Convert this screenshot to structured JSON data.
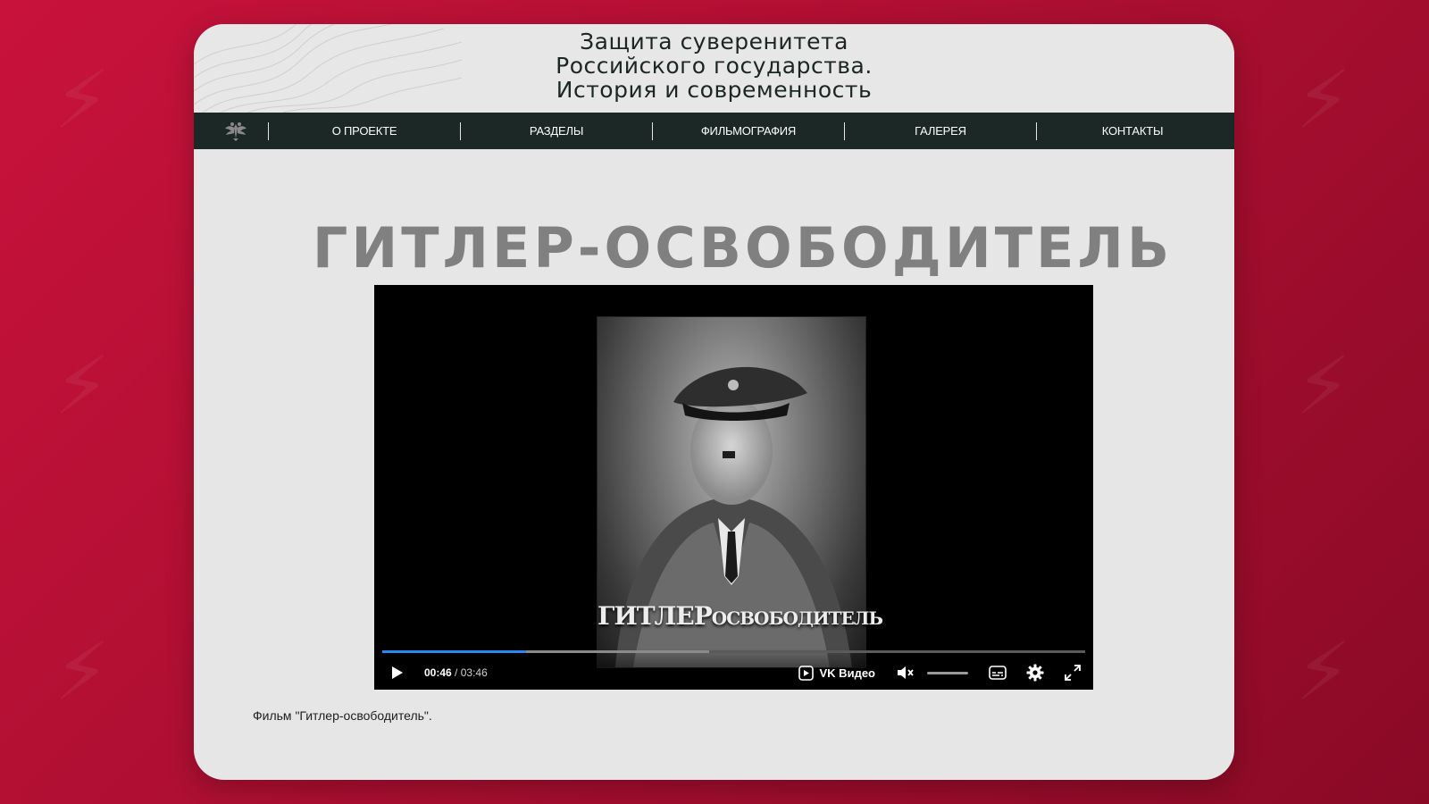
{
  "site": {
    "title_lines": [
      "Защита суверенитета",
      "Российского государства.",
      "История и современность"
    ]
  },
  "nav": {
    "logo_icon": "double-headed-eagle-icon",
    "items": [
      "О ПРОЕКТЕ",
      "РАЗДЕЛЫ",
      "ФИЛЬМОГРАФИЯ",
      "ГАЛЕРЕЯ",
      "КОНТАКТЫ"
    ]
  },
  "page": {
    "heading": "ГИТЛЕР-ОСВОБОДИТЕЛЬ",
    "caption": "Фильм \"Гитлер-освободитель\"."
  },
  "player": {
    "poster_text_large": "ГИТЛЕР",
    "poster_text_small": "ОСВОБОДИТЕЛЬ",
    "current_time": "00:46",
    "time_separator": " / ",
    "duration": "03:46",
    "played_fraction": 0.205,
    "buffered_fraction": 0.465,
    "brand_label": "VK Видео",
    "muted": true,
    "colors": {
      "progress": "#2787f5"
    }
  },
  "colors": {
    "background": "#c8123c",
    "card": "#e6e6e6",
    "nav": "#1b2826",
    "heading": "#808080"
  }
}
